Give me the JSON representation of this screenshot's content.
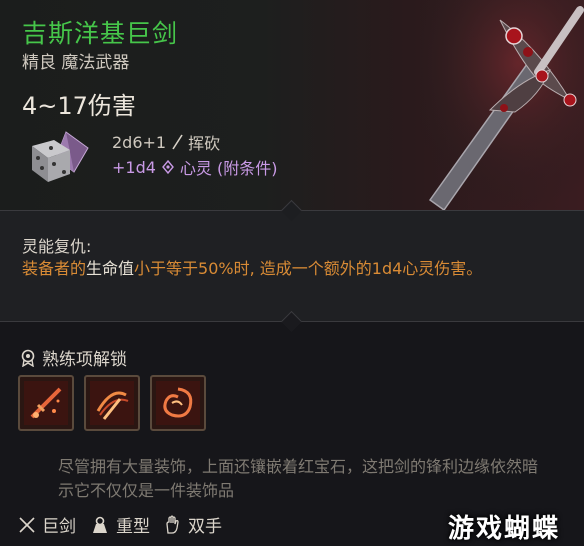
{
  "item": {
    "name": "吉斯洋基巨剑",
    "rarity_type": "精良 魔法武器",
    "damage_total": "4~17伤害",
    "damage_lines": [
      {
        "dice": "2d6+1",
        "type": "挥砍"
      },
      {
        "dice": "+1d4",
        "type": "心灵 (附条件)"
      }
    ]
  },
  "passive": {
    "name": "灵能复仇:",
    "desc_before": "装备者的",
    "desc_highlight": "生命值",
    "desc_after": "小于等于50%时, 造成一个额外的1d4心灵伤害。"
  },
  "proficiency": {
    "header": "熟练项解锁",
    "items": [
      {
        "icon": "sword-strike-skill-icon"
      },
      {
        "icon": "cleave-skill-icon"
      },
      {
        "icon": "swirl-slash-skill-icon"
      }
    ]
  },
  "flavor_text": "尽管拥有大量装饰，上面还镶嵌着红宝石，这把剑的锋利边缘依然暗示它不仅仅是一件装饰品",
  "properties": [
    {
      "icon": "crossed-swords-icon",
      "label": "巨剑"
    },
    {
      "icon": "heavy-weight-icon",
      "label": "重型"
    },
    {
      "icon": "hand-icon",
      "label": "双手"
    }
  ],
  "watermark": "游戏蝴蝶",
  "colors": {
    "title": "#46c64a",
    "psychic": "#c99ae6",
    "passive": "#d98b35"
  }
}
